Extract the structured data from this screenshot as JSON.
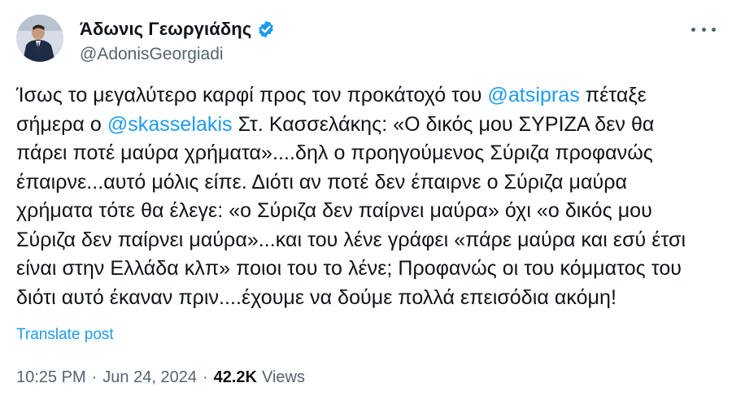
{
  "author": {
    "display_name": "Άδωνις Γεωργιάδης",
    "handle": "@AdonisGeorgiadi",
    "verified_icon": "verified-badge-icon",
    "verified_color": "#1d9bf0",
    "avatar": "profile-photo"
  },
  "more_icon": "more-options-icon",
  "tweet": {
    "lines": [
      [
        "Ίσως το μεγαλύτερο καρφί προς τον προκάτοχό του ",
        "@atsipras",
        " πέταξε"
      ],
      [
        "σήμερα ο ",
        "@skasselakis",
        " Στ. Κασσελάκης: «Ο δικός μου ΣΥΡΙΖΑ δεν θα"
      ],
      [
        "πάρει ποτέ μαύρα χρήματα»....δηλ ο προηγούμενος Σύριζα προφανώς"
      ],
      [
        "έπαιρνε...αυτό μόλις είπε. Διότι αν ποτέ δεν έπαιρνε ο Σύριζα μαύρα"
      ],
      [
        "χρήματα τότε θα έλεγε: «ο Σύριζα δεν παίρνει μαύρα» όχι «ο δικός μου"
      ],
      [
        "Σύριζα δεν παίρνει μαύρα»...και του λένε γράφει «πάρε μαύρα και εσύ έτσι"
      ],
      [
        "είναι στην Ελλάδα κλπ» ποιοι του το λένε; Προφανώς οι του κόμματος του"
      ],
      [
        "διότι αυτό έκαναν πριν....έχουμε να δούμε πολλά επεισόδια ακόμη!"
      ]
    ],
    "mentions": [
      "@atsipras",
      "@skasselakis"
    ]
  },
  "translate_label": "Translate post",
  "meta": {
    "time": "10:25 PM",
    "separator": "·",
    "date": "Jun 24, 2024",
    "views_count": "42.2K",
    "views_label": "Views"
  },
  "colors": {
    "link": "#1d9bf0",
    "text": "#0f1419",
    "secondary": "#536471"
  }
}
